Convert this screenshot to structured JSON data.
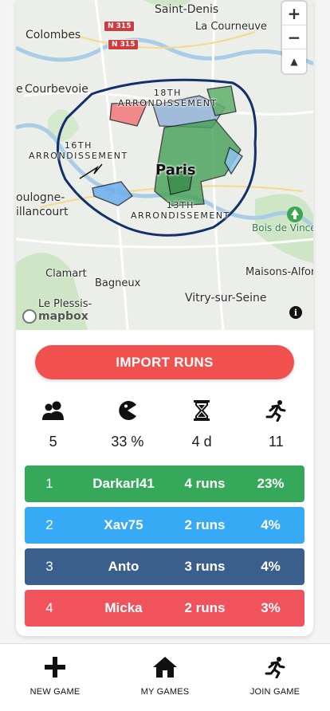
{
  "map": {
    "places": [
      {
        "id": "saint-denis",
        "label": "Saint-Denis"
      },
      {
        "id": "colombes",
        "label": "Colombes"
      },
      {
        "id": "la-courneuve",
        "label": "La Courneuve"
      },
      {
        "id": "courbevoie",
        "label": "Courbevoie"
      },
      {
        "id": "boulogne-1",
        "label": "oulogne-"
      },
      {
        "id": "boulogne-2",
        "label": "illancourt"
      },
      {
        "id": "bois-vincennes",
        "label": "Bois de Vince"
      },
      {
        "id": "clamart",
        "label": "Clamart"
      },
      {
        "id": "bagneux",
        "label": "Bagneux"
      },
      {
        "id": "maisons-alfort",
        "label": "Maisons-Alfor"
      },
      {
        "id": "vitry",
        "label": "Vitry-sur-Seine"
      },
      {
        "id": "le-plessis",
        "label": "Le Plessis-"
      }
    ],
    "partial_b": "E",
    "partial_e": "e",
    "districts": {
      "d18_1": "18TH",
      "d18_2": "ARRONDISSEMENT",
      "d16_1": "16TH",
      "d16_2": "ARRONDISSEMENT",
      "d13_1": "13TH",
      "d13_2": "ARRONDISSEMENT"
    },
    "city": "Paris",
    "roads": [
      "N 315",
      "N 315"
    ],
    "zoom_in": "+",
    "zoom_out": "−",
    "compass": "▲",
    "logo": "mapbox",
    "info": "i"
  },
  "actions": {
    "import_runs": "IMPORT RUNS"
  },
  "stats": [
    {
      "icon": "players-icon",
      "value": "5"
    },
    {
      "icon": "pacman-icon",
      "value": "33 %"
    },
    {
      "icon": "hourglass-icon",
      "value": "4 d"
    },
    {
      "icon": "runner-icon",
      "value": "11"
    }
  ],
  "leaderboard": [
    {
      "rank": "1",
      "name": "Darkarl41",
      "runs": "4 runs",
      "pct": "23%",
      "color": "#36a85a"
    },
    {
      "rank": "2",
      "name": "Xav75",
      "runs": "2 runs",
      "pct": "4%",
      "color": "#37aaf5"
    },
    {
      "rank": "3",
      "name": "Anto",
      "runs": "3 runs",
      "pct": "4%",
      "color": "#3b5f8c"
    },
    {
      "rank": "4",
      "name": "Micka",
      "runs": "2 runs",
      "pct": "3%",
      "color": "#f1535c"
    }
  ],
  "nav": [
    {
      "label": "NEW GAME",
      "icon": "plus-icon"
    },
    {
      "label": "MY GAMES",
      "icon": "home-icon"
    },
    {
      "label": "JOIN GAME",
      "icon": "runner-icon"
    }
  ]
}
